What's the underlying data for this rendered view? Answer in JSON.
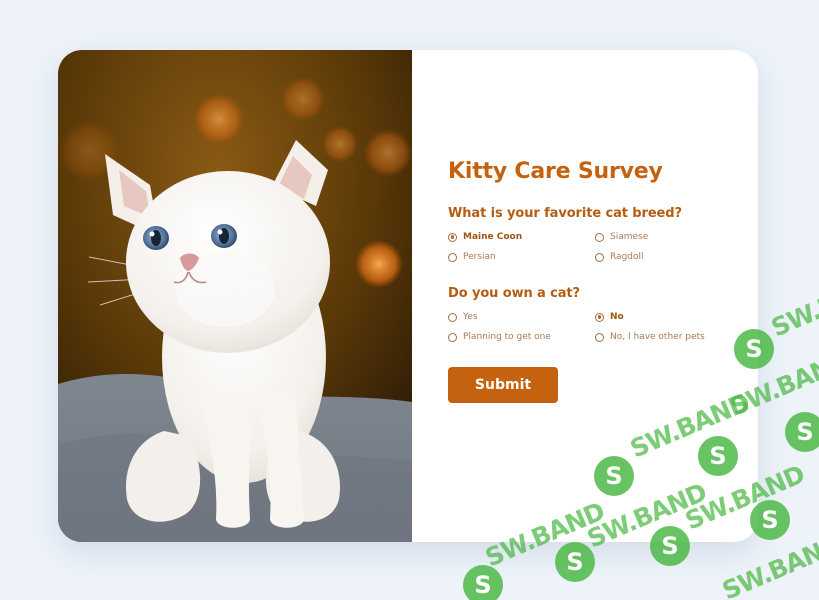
{
  "survey": {
    "title": "Kitty Care Survey",
    "questions": [
      {
        "label": "What is your favorite cat breed?",
        "options": [
          {
            "label": "Maine Coon",
            "selected": true
          },
          {
            "label": "Siamese",
            "selected": false
          },
          {
            "label": "Persian",
            "selected": false
          },
          {
            "label": "Ragdoll",
            "selected": false
          }
        ]
      },
      {
        "label": "Do you own a cat?",
        "options": [
          {
            "label": "Yes",
            "selected": false
          },
          {
            "label": "No",
            "selected": true
          },
          {
            "label": "Planning to get one",
            "selected": false
          },
          {
            "label": "No, I have other pets",
            "selected": false
          }
        ]
      }
    ],
    "submit_label": "Submit"
  },
  "photo": {
    "subject": "white kitten sitting on a gray blanket"
  },
  "watermark": {
    "text": "SW.BAND",
    "logo_glyph": "S"
  },
  "colors": {
    "accent": "#c4620f",
    "title": "#c4620f",
    "question": "#b65c12",
    "option_text": "#a97a55",
    "page_background": "#eef3fa",
    "card_background": "#ffffff",
    "watermark_green": "#47b73f"
  }
}
